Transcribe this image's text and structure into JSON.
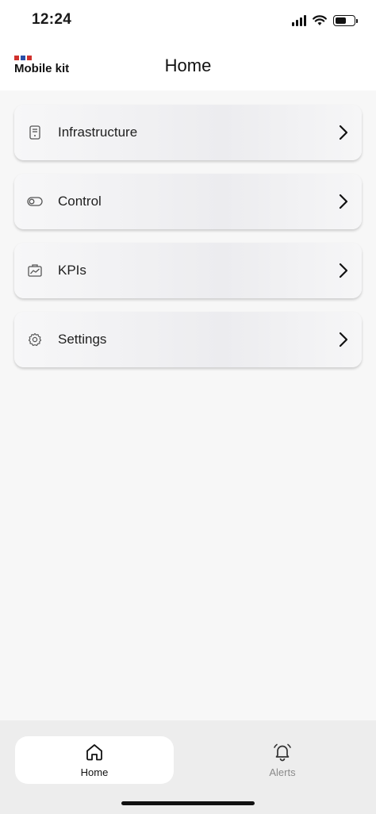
{
  "status_bar": {
    "time": "12:24",
    "signal_icon": "cellular-signal-icon",
    "wifi_icon": "wifi-icon",
    "battery_icon": "battery-icon",
    "battery_level": 0.6
  },
  "header": {
    "logo_text": "Mobile kit",
    "title": "Home"
  },
  "menu": {
    "items": [
      {
        "label": "Infrastructure",
        "icon": "server-icon"
      },
      {
        "label": "Control",
        "icon": "toggle-icon"
      },
      {
        "label": "KPIs",
        "icon": "chart-icon"
      },
      {
        "label": "Settings",
        "icon": "gear-icon"
      }
    ],
    "chevron_icon": "chevron-right-icon"
  },
  "tabbar": {
    "home_label": "Home",
    "home_icon": "home-icon",
    "alerts_label": "Alerts",
    "alerts_icon": "bell-icon",
    "active": "Home"
  },
  "colors": {
    "logo_red": "#d0312d",
    "logo_blue": "#2a4fa8",
    "inactive_tab_text": "#8a8a8a"
  }
}
